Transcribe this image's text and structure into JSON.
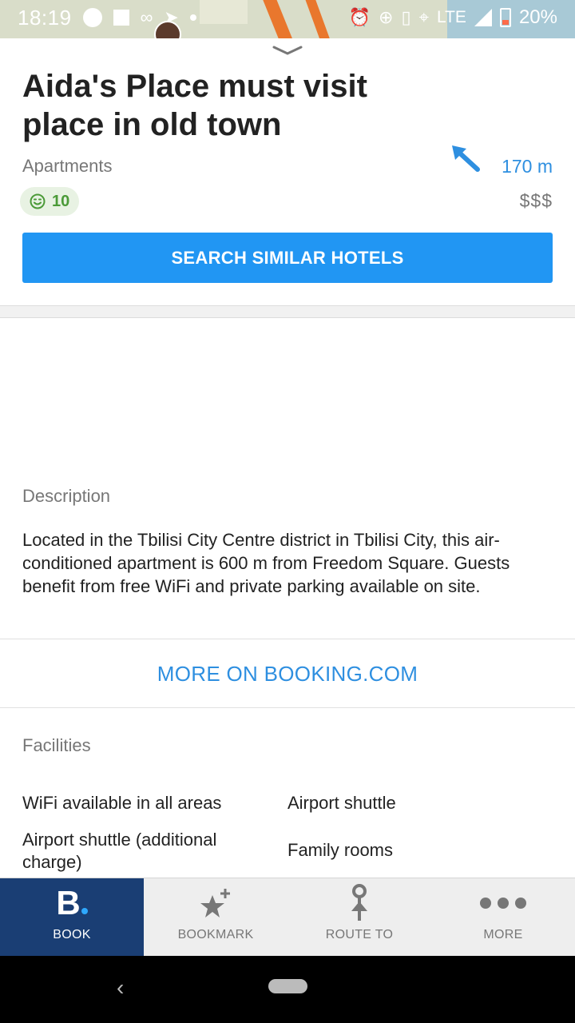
{
  "status_bar": {
    "time": "18:19",
    "network": "LTE",
    "battery": "20%",
    "icons": [
      "telegram-icon",
      "square-icon",
      "link-icon",
      "location-arrow-icon",
      "dot-icon",
      "alarm-icon",
      "data-saver-icon",
      "vibrate-icon",
      "location-pin-icon",
      "signal-icon",
      "battery-icon"
    ]
  },
  "place": {
    "title": "Aida's Place must visit place in old town",
    "category": "Apartments",
    "distance": "170 m",
    "rating": "10",
    "price": "$$$"
  },
  "actions": {
    "search_similar": "SEARCH SIMILAR HOTELS"
  },
  "description": {
    "label": "Description",
    "text": "Located in the Tbilisi City Centre district in Tbilisi City, this air-conditioned apartment is 600 m from Freedom Square. Guests benefit from free WiFi and private parking available on site."
  },
  "links": {
    "more_booking": "MORE ON BOOKING.COM"
  },
  "facilities": {
    "label": "Facilities",
    "items": [
      "WiFi available in all areas",
      "Airport shuttle",
      "Airport shuttle (additional charge)",
      "Family rooms"
    ]
  },
  "bottom_tabs": [
    {
      "label": "BOOK",
      "icon": "booking-logo-icon",
      "active": true
    },
    {
      "label": "BOOKMARK",
      "icon": "star-plus-icon",
      "active": false
    },
    {
      "label": "ROUTE TO",
      "icon": "route-pin-icon",
      "active": false
    },
    {
      "label": "MORE",
      "icon": "more-dots-icon",
      "active": false
    }
  ],
  "colors": {
    "accent": "#2196f3",
    "link": "#2e8fe0",
    "booking_blue": "#1a3e74",
    "rating_green": "#4b9a38"
  }
}
